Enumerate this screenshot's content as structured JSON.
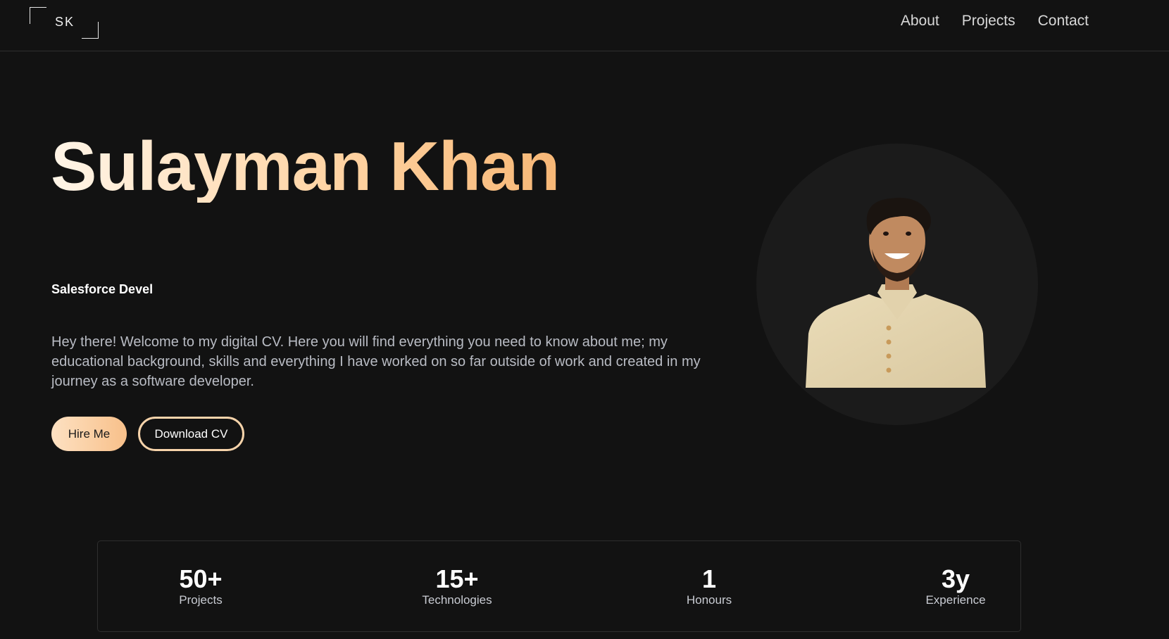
{
  "header": {
    "logo_text": "SK",
    "nav": [
      "About",
      "Projects",
      "Contact"
    ]
  },
  "hero": {
    "name": "Sulayman Khan",
    "subtitle": "Salesforce Devel",
    "intro": "Hey there! Welcome to my digital CV. Here you will find everything you need to know about me; my educational background, skills and everything I have worked on so far outside of work and created in my journey as a software developer.",
    "hire_label": "Hire Me",
    "download_label": "Download CV"
  },
  "stats": [
    {
      "value": "50+",
      "label": "Projects"
    },
    {
      "value": "15+",
      "label": "Technologies"
    },
    {
      "value": "1",
      "label": "Honours"
    },
    {
      "value": "3y",
      "label": "Experience"
    }
  ],
  "colors": {
    "background": "#121212",
    "accent_light": "#fde1c2",
    "accent": "#f8c08a"
  },
  "icons": {
    "portrait": "profile-photo"
  }
}
